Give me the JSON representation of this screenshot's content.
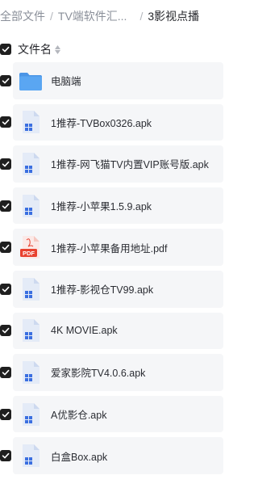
{
  "breadcrumb": {
    "items": [
      "全部文件",
      "TV端软件汇...",
      "3影视点播"
    ]
  },
  "list_header": {
    "column_label": "文件名"
  },
  "files": [
    {
      "name": "电脑端",
      "type": "folder"
    },
    {
      "name": "1推荐-TVBox0326.apk",
      "type": "apk"
    },
    {
      "name": "1推荐-网飞猫TV内置VIP账号版.apk",
      "type": "apk"
    },
    {
      "name": "1推荐-小苹果1.5.9.apk",
      "type": "apk"
    },
    {
      "name": "1推荐-小苹果备用地址.pdf",
      "type": "pdf"
    },
    {
      "name": "1推荐-影视仓TV99.apk",
      "type": "apk"
    },
    {
      "name": "4K MOVIE.apk",
      "type": "apk"
    },
    {
      "name": "爱家影院TV4.0.6.apk",
      "type": "apk"
    },
    {
      "name": "A优影仓.apk",
      "type": "apk"
    },
    {
      "name": "白盒Box.apk",
      "type": "apk"
    }
  ],
  "pdf_icon_label": "PDF",
  "colors": {
    "folder": "#5aa6f2",
    "apk_page": "#e4ebf7",
    "apk_grid": "#3b6fe0",
    "pdf_red": "#e8412f",
    "checkbox": "#1f1f1f",
    "row_bg": "#f5f6f8"
  }
}
